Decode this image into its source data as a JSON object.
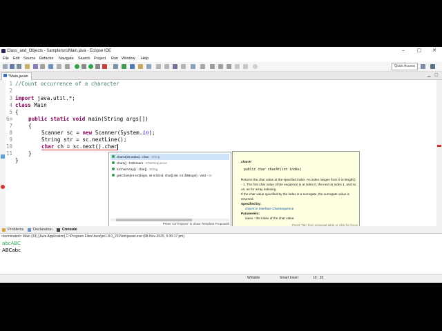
{
  "window": {
    "title": "Class_and_Objects - Sample/src/Main.java - Eclipse IDE",
    "min": "–",
    "max": "▢",
    "close": "✕"
  },
  "menu": [
    "File",
    "Edit",
    "Source",
    "Refactor",
    "Navigate",
    "Search",
    "Project",
    "Run",
    "Window",
    "Help"
  ],
  "quick_access": "Quick Access",
  "editor_tab": {
    "label": "*Main.java",
    "close": "✕"
  },
  "code": {
    "line_numbers": [
      "1",
      "2",
      "3",
      "4",
      "5",
      "6⊖",
      "7",
      "8",
      "9",
      "10",
      "11"
    ],
    "l1": "//Count occurrence of a character",
    "l3_kw": "import",
    "l3_rest": " java.util.*;",
    "l4_kw": "class",
    "l4_rest": " Main",
    "l5": "{",
    "l6_kw": "public static void",
    "l6_rest": " main(String args[])",
    "l7": "{",
    "l8_a": "Scanner sc = ",
    "l8_kw": "new",
    "l8_b": " Scanner(System.",
    "l8_in": "in",
    "l8_c": ");",
    "l9": "String str = sc.nextLine();",
    "l10_kw": "char",
    "l10_rest": " ch = sc.next().char",
    "l11": "}",
    "l12": "}"
  },
  "completions": [
    {
      "name": "charAt(int index) : char",
      "type": " - String"
    },
    {
      "name": "chars() : IntStream",
      "type": " - CharSequence"
    },
    {
      "name": "toCharArray() : char[]",
      "type": " - String"
    },
    {
      "name": "getChars(int srcBegin, int srcEnd, char[] dst, int dstBegin) : void",
      "type": " - St"
    }
  ],
  "popup_footer": "Press 'Ctrl+Space' to show Template Proposals",
  "doc": {
    "heading": "charAt",
    "signature": "public char charAt(int index)",
    "body1": "Returns the char value at the specified index. An index ranges from 0 to length() - 1. The first char value of the sequence is at index 0, the next at index 1, and so on, as for array indexing.",
    "body2": "If the char value specified by the index is a surrogate, the surrogate value is returned.",
    "spec_label": "Specified by:",
    "spec_value": "charAt in interface CharSequence",
    "params_label": "Parameters:",
    "param": "index - the index of the char value.",
    "footer": "Press 'Tab' from proposal table or click for focus"
  },
  "bottom_tabs": [
    "Problems",
    "Declaration",
    "Console"
  ],
  "console": {
    "header": "<terminated> Main (33) [Java Application] C:\\Program Files\\Java\\jre1.8.0_231\\bin\\javaw.exe (08-Nov-2025, 5:30:17 pm)",
    "input": "abcABC",
    "output": "ABCabc"
  },
  "status": {
    "writable": "Writable",
    "insert": "Smart Insert",
    "pos": "10 : 33"
  },
  "colors": {
    "accent": "#0050a0",
    "input": "#22a84a",
    "keyword": "#7f0055"
  }
}
